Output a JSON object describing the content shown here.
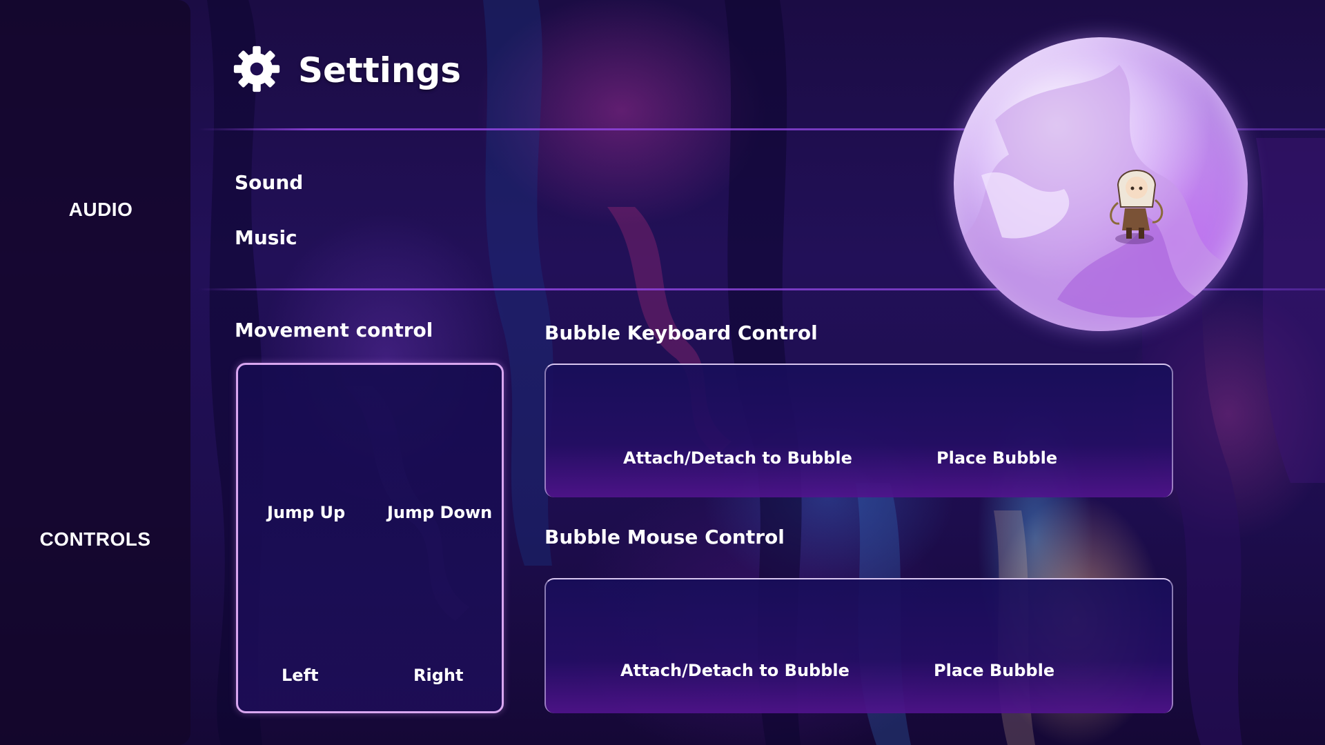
{
  "header": {
    "title": "Settings",
    "icon": "gear-icon"
  },
  "sidebar": {
    "categories": [
      {
        "label": "AUDIO"
      },
      {
        "label": "CONTROLS"
      }
    ]
  },
  "audio": {
    "sound_label": "Sound",
    "music_label": "Music"
  },
  "controls": {
    "movement": {
      "title": "Movement control",
      "jump_up": "Jump Up",
      "jump_down": "Jump Down",
      "left": "Left",
      "right": "Right"
    },
    "bubble_keyboard": {
      "title": "Bubble Keyboard Control",
      "attach_detach": "Attach/Detach to Bubble",
      "place_bubble": "Place Bubble"
    },
    "bubble_mouse": {
      "title": "Bubble Mouse Control",
      "attach_detach": "Attach/Detach to Bubble",
      "place_bubble": "Place Bubble"
    }
  },
  "colors": {
    "accent_purple": "#9b5de5",
    "panel_border": "#d9a7f0",
    "sidebar_bg": "#14062a"
  }
}
